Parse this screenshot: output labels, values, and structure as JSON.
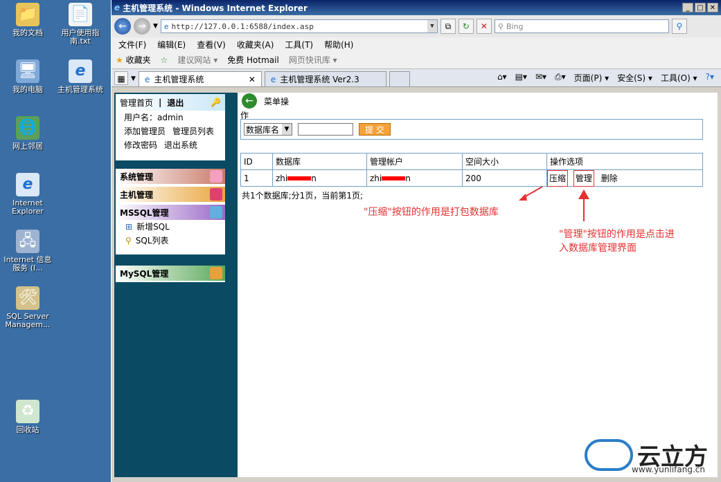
{
  "desktop": {
    "icons": [
      {
        "label": "我的文档",
        "glyph": "📁"
      },
      {
        "label": "用户使用指南.txt",
        "glyph": "📄"
      },
      {
        "label": "我的电脑",
        "glyph": "🖥"
      },
      {
        "label": "主机管理系统",
        "glyph": "e"
      },
      {
        "label": "网上邻居",
        "glyph": "🌐"
      },
      {
        "label": "Internet Explorer",
        "glyph": "e"
      },
      {
        "label": "Internet 信息服务 (I...",
        "glyph": "🖧"
      },
      {
        "label": "SQL Server Managem...",
        "glyph": "🛠"
      },
      {
        "label": "回收站",
        "glyph": "♻"
      }
    ]
  },
  "window": {
    "title": "主机管理系统 - Windows Internet Explorer",
    "address": "http://127.0.0.1:6588/index.asp",
    "search_placeholder": "Bing",
    "menu": [
      "文件(F)",
      "编辑(E)",
      "查看(V)",
      "收藏夹(A)",
      "工具(T)",
      "帮助(H)"
    ],
    "favorites": {
      "label": "收藏夹",
      "items": [
        "建议网站 ▾",
        "免费 Hotmail",
        "网页快讯库 ▾"
      ]
    },
    "tabs": [
      "主机管理系统",
      "主机管理系统 Ver2.3"
    ],
    "tools": [
      "页面(P) ▾",
      "安全(S) ▾",
      "工具(O) ▾"
    ]
  },
  "sidebar": {
    "home": "管理首页",
    "logout": "退出",
    "username_label": "用户名：admin",
    "links_row1": [
      "添加管理员",
      "管理员列表"
    ],
    "links_row2": [
      "修改密码",
      "退出系统"
    ],
    "sections": [
      "系统管理",
      "主机管理",
      "MSSQL管理",
      "MySQL管理"
    ],
    "mssql_items": [
      "新增SQL",
      "SQL列表"
    ]
  },
  "main": {
    "menu_label": "菜单操",
    "menu_label_wrap": "作",
    "select_value": "数据库名",
    "submit": "提 交",
    "table": {
      "headers": [
        "ID",
        "数据库",
        "管理帐户",
        "空间大小",
        "操作选项"
      ],
      "row": {
        "id": "1",
        "database_prefix": "zhi",
        "database_suffix": "n",
        "account_prefix": "zhi",
        "account_suffix": "n",
        "size": "200",
        "actions": [
          "压缩",
          "管理",
          "删除"
        ]
      }
    },
    "footer": "共1个数据库;分1页，当前第1页;"
  },
  "annotations": {
    "compress": "\"压缩\"按钮的作用是打包数据库",
    "manage_line1": "\"管理\"按钮的作用是点击进",
    "manage_line2": "入数据库管理界面"
  },
  "logo": {
    "text": "云立方",
    "url": "www.yunlifang.cn"
  }
}
